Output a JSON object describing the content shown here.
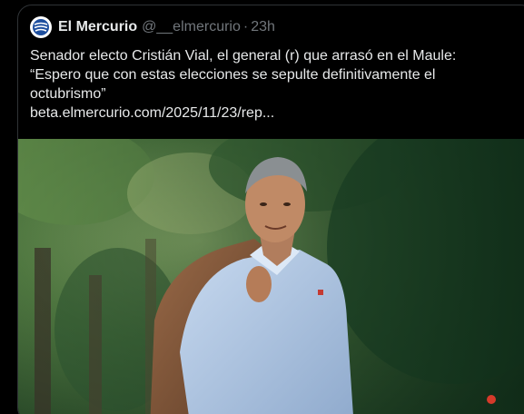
{
  "tweet": {
    "author": {
      "name": "El Mercurio",
      "handle": "@__elmercurio",
      "separator": "·",
      "time": "23h",
      "avatar_icon": "newspaper-logo-icon",
      "avatar_color": "#1d4e9e"
    },
    "text": {
      "line1": "Senador electo Cristián Vial, el general (r) que arrasó en el Maule:",
      "line2": "“Espero que con estas elecciones se sepulte definitivamente el",
      "line3": "octubrismo”",
      "link": "beta.elmercurio.com/2025/11/23/rep..."
    },
    "media": {
      "type": "photo",
      "subject": "older man in light-blue shirt holding brown jacket over shoulder, trees in background"
    }
  },
  "colors": {
    "background": "#000000",
    "text_primary": "#e7e9ea",
    "text_secondary": "#71767b",
    "border": "#2f3336"
  }
}
